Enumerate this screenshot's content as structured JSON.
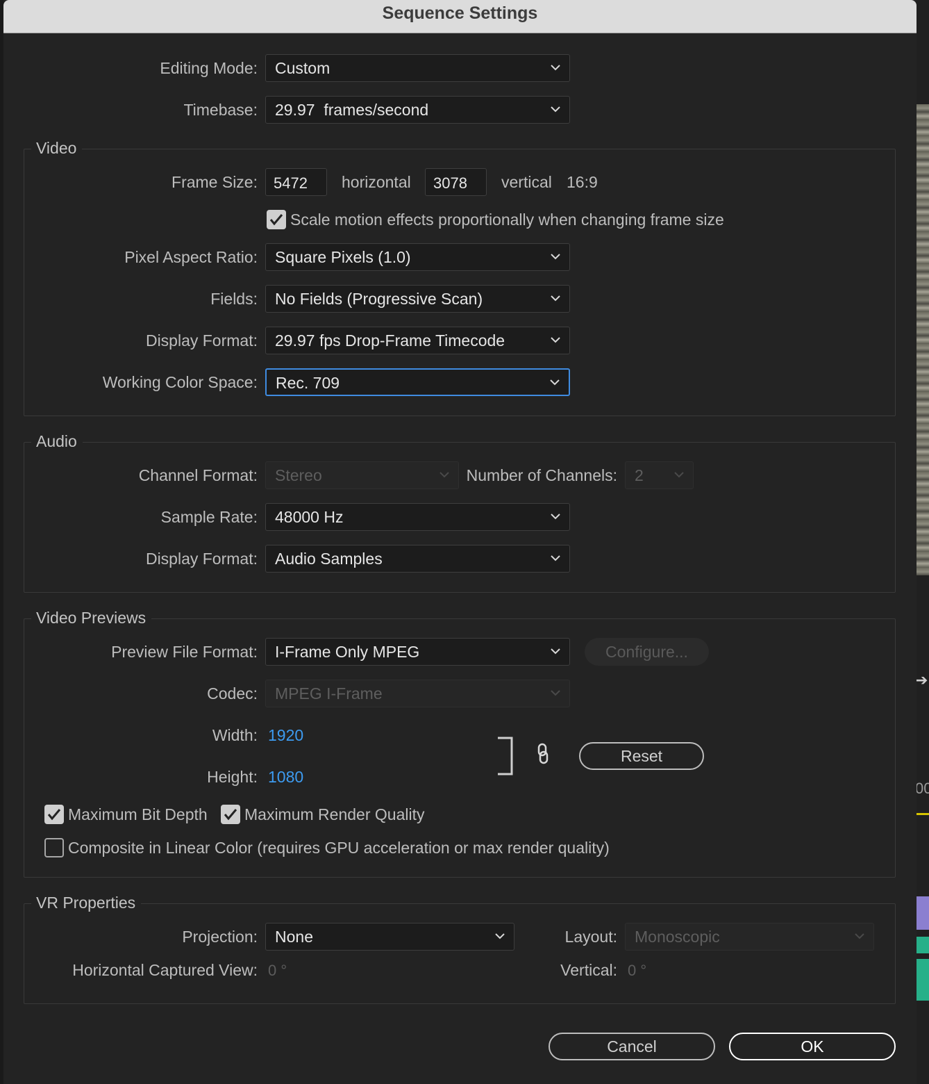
{
  "dialog": {
    "title": "Sequence Settings"
  },
  "general": {
    "editing_mode_label": "Editing Mode:",
    "editing_mode_value": "Custom",
    "timebase_label": "Timebase:",
    "timebase_value": "29.97  frames/second"
  },
  "video": {
    "title": "Video",
    "frame_size_label": "Frame Size:",
    "frame_width": "5472",
    "horizontal_label": "horizontal",
    "frame_height": "3078",
    "vertical_label": "vertical",
    "aspect_ratio": "16:9",
    "scale_motion_label": "Scale motion effects proportionally when changing frame size",
    "scale_motion_checked": true,
    "pixel_aspect_label": "Pixel Aspect Ratio:",
    "pixel_aspect_value": "Square Pixels (1.0)",
    "fields_label": "Fields:",
    "fields_value": "No Fields (Progressive Scan)",
    "display_format_label": "Display Format:",
    "display_format_value": "29.97 fps Drop-Frame Timecode",
    "color_space_label": "Working Color Space:",
    "color_space_value": "Rec. 709"
  },
  "audio": {
    "title": "Audio",
    "channel_format_label": "Channel Format:",
    "channel_format_value": "Stereo",
    "num_channels_label": "Number of Channels:",
    "num_channels_value": "2",
    "sample_rate_label": "Sample Rate:",
    "sample_rate_value": "48000 Hz",
    "display_format_label": "Display Format:",
    "display_format_value": "Audio Samples"
  },
  "previews": {
    "title": "Video Previews",
    "file_format_label": "Preview File Format:",
    "file_format_value": "I-Frame Only MPEG",
    "configure_label": "Configure...",
    "codec_label": "Codec:",
    "codec_value": "MPEG I-Frame",
    "width_label": "Width:",
    "width_value": "1920",
    "height_label": "Height:",
    "height_value": "1080",
    "reset_label": "Reset",
    "max_bit_depth_label": "Maximum Bit Depth",
    "max_bit_depth_checked": true,
    "max_render_quality_label": "Maximum Render Quality",
    "max_render_quality_checked": true,
    "linear_color_label": "Composite in Linear Color (requires GPU acceleration or max render quality)",
    "linear_color_checked": false
  },
  "vr": {
    "title": "VR Properties",
    "projection_label": "Projection:",
    "projection_value": "None",
    "layout_label": "Layout:",
    "layout_value": "Monoscopic",
    "h_view_label": "Horizontal Captured View:",
    "h_view_value": "0 °",
    "vertical_label": "Vertical:",
    "vertical_value": "0 °"
  },
  "buttons": {
    "cancel_label": "Cancel",
    "ok_label": "OK"
  },
  "background": {
    "edge_text": "00"
  },
  "colors": {
    "accent": "#3f8be0",
    "link_value": "#3d9bf0",
    "dialog_bg": "#232323",
    "titlebar_bg": "#dcdcdc"
  }
}
